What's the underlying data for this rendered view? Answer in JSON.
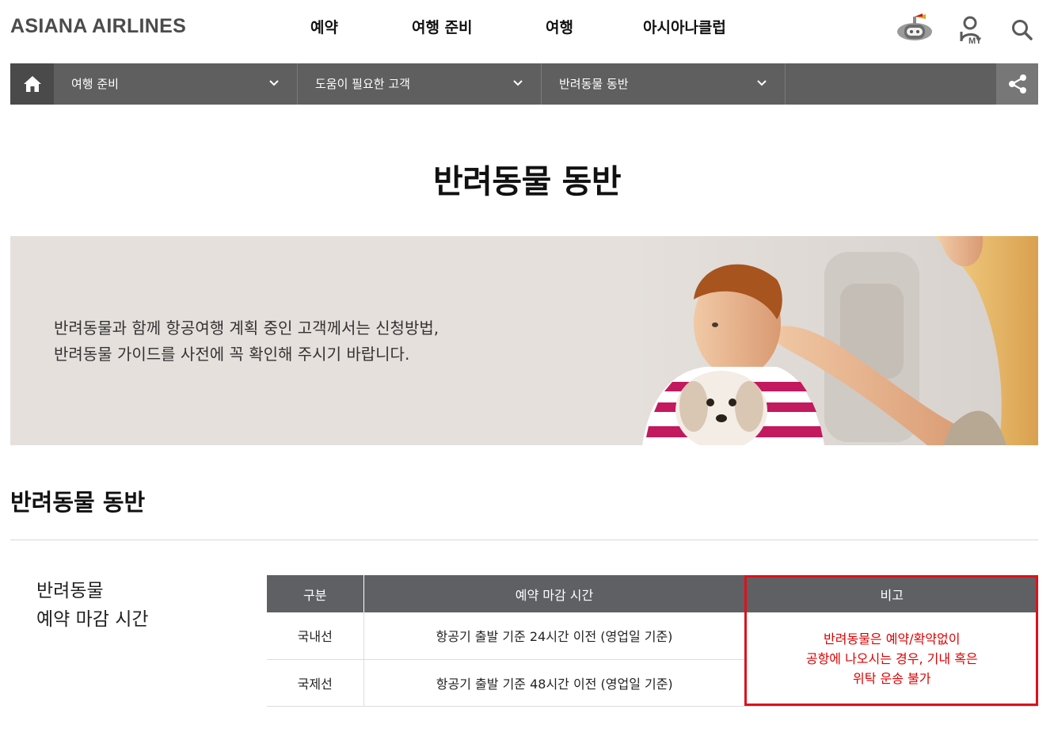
{
  "header": {
    "logo": "ASIANA AIRLINES",
    "nav": [
      "예약",
      "여행 준비",
      "여행",
      "아시아나클럽"
    ],
    "icons": [
      "chatbot-icon",
      "my-page-icon",
      "search-icon"
    ],
    "my_label": "MY"
  },
  "subnav": {
    "crumbs": [
      "여행 준비",
      "도움이 필요한 고객",
      "반려동물 동반"
    ]
  },
  "page": {
    "title": "반려동물 동반"
  },
  "banner": {
    "line1": "반려동물과 함께 항공여행 계획 중인 고객께서는 신청방법,",
    "line2": "반려동물 가이드를 사전에 꼭 확인해 주시기 바랍니다."
  },
  "section": {
    "title": "반려동물 동반",
    "side_label_line1": "반려동물",
    "side_label_line2": "예약 마감 시간"
  },
  "table": {
    "headers": [
      "구분",
      "예약 마감 시간",
      "비고"
    ],
    "rows": [
      [
        "국내선",
        "항공기 출발 기준 24시간 이전 (영업일 기준)"
      ],
      [
        "국제선",
        "항공기 출발 기준 48시간 이전 (영업일 기준)"
      ]
    ],
    "note_lines": [
      "반려동물은 예약/확약없이",
      "공항에 나오시는 경우, 기내 혹은",
      "위탁 운송 불가"
    ]
  },
  "colors": {
    "subnav_bg": "#5f5f5f",
    "table_header_bg": "#5f6063",
    "note_red": "#e00000",
    "banner_bg": "#e5e0dc"
  }
}
